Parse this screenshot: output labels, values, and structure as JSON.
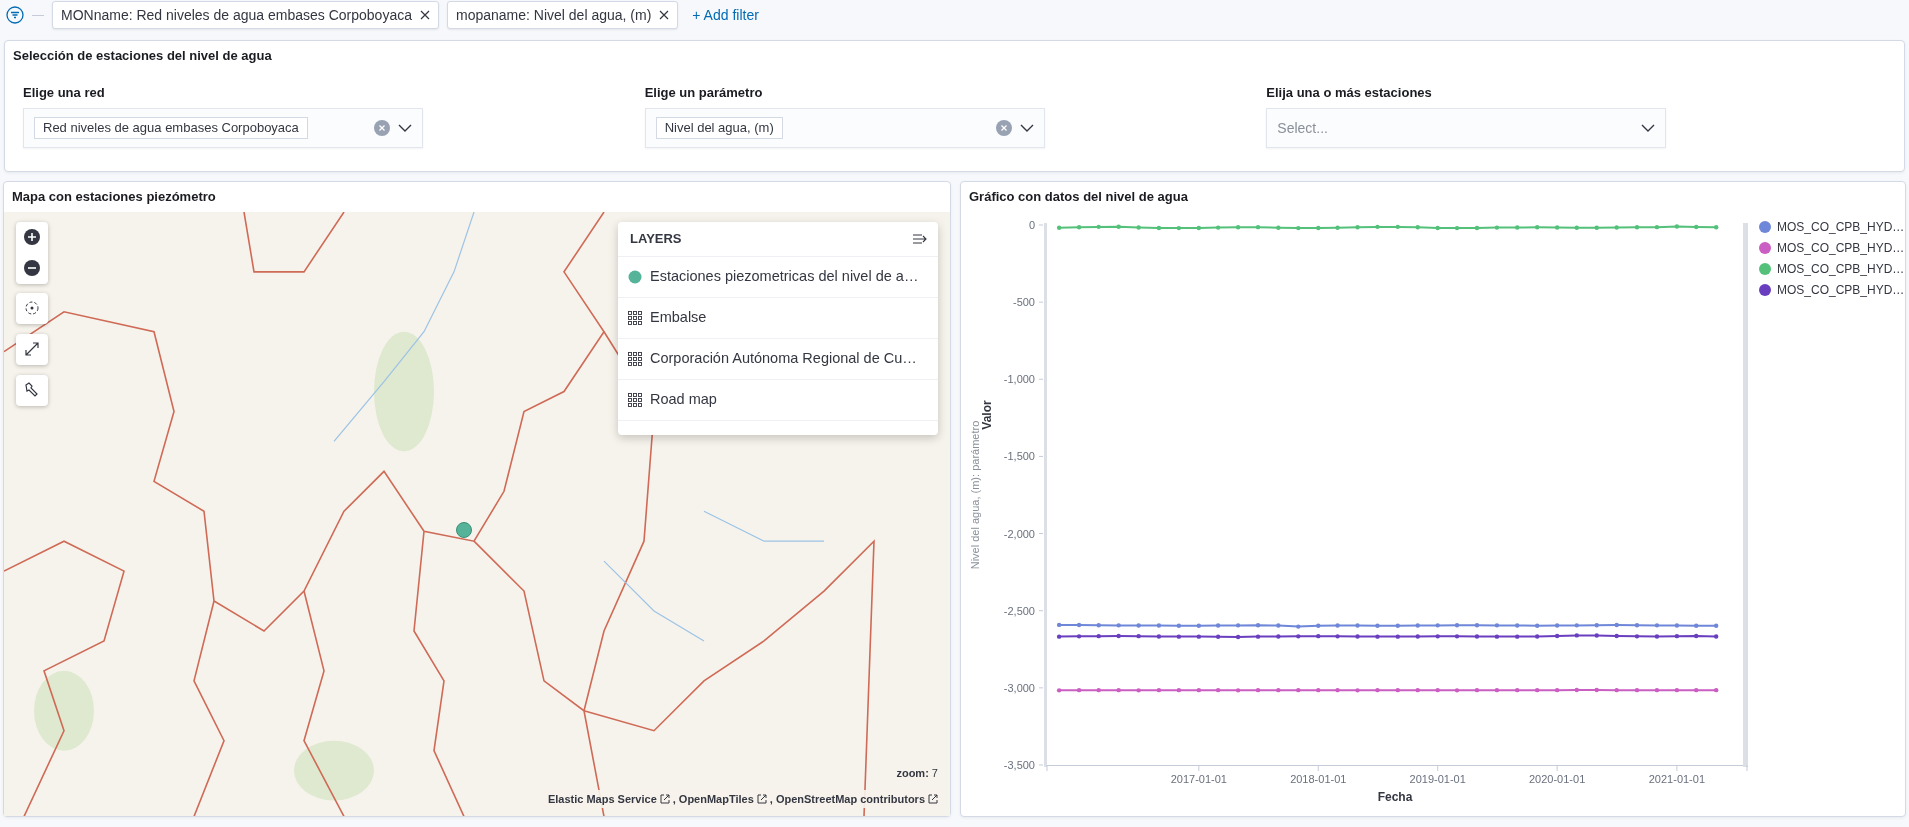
{
  "filter_bar": {
    "filters": [
      {
        "label": "MONname: Red niveles de agua embases Corpoboyaca"
      },
      {
        "label": "mopaname: Nivel del agua, (m)"
      }
    ],
    "add_filter": "+ Add filter"
  },
  "selection_panel": {
    "title": "Selección de estaciones del nivel de agua",
    "controls": [
      {
        "label": "Elige una red",
        "value": "Red niveles de agua embases Corpoboyaca"
      },
      {
        "label": "Elige un parámetro",
        "value": "Nivel del agua, (m)"
      },
      {
        "label": "Elija una o más estaciones",
        "placeholder": "Select..."
      }
    ]
  },
  "map_panel": {
    "title": "Mapa con estaciones piezómetro",
    "layers": {
      "title": "LAYERS",
      "items": [
        {
          "kind": "point",
          "label": "Estaciones piezometricas del nivel de a…"
        },
        {
          "kind": "tile",
          "label": "Embalse"
        },
        {
          "kind": "tile",
          "label": "Corporación Autónoma Regional de Cu…"
        },
        {
          "kind": "tile",
          "label": "Road map"
        }
      ]
    },
    "zoom": {
      "label": "zoom:",
      "value": "7"
    },
    "attribution_separator": ",",
    "attribution": [
      {
        "text": "Elastic Maps Service"
      },
      {
        "text": "OpenMapTiles"
      },
      {
        "text": "OpenStreetMap contributors"
      }
    ]
  },
  "chart_panel": {
    "title": "Gráfico con datos del nivel de agua",
    "axis_caption": "Nivel del agua, (m): parámetro",
    "chart_data": {
      "type": "line",
      "xlabel": "Fecha",
      "ylabel": "Valor",
      "x": [
        "2015-11-01",
        "2016-01-01",
        "2016-03-01",
        "2016-05-01",
        "2016-07-01",
        "2016-09-01",
        "2016-11-01",
        "2017-01-01",
        "2017-03-01",
        "2017-05-01",
        "2017-07-01",
        "2017-09-01",
        "2017-11-01",
        "2018-01-01",
        "2018-03-01",
        "2018-05-01",
        "2018-07-01",
        "2018-09-01",
        "2018-11-01",
        "2019-01-01",
        "2019-03-01",
        "2019-05-01",
        "2019-07-01",
        "2019-09-01",
        "2019-11-01",
        "2020-01-01",
        "2020-03-01",
        "2020-05-01",
        "2020-07-01",
        "2020-09-01",
        "2020-11-01",
        "2021-01-01",
        "2021-03-01",
        "2021-05-01"
      ],
      "xlim": [
        "2015-09-25",
        "2021-07-22"
      ],
      "ylim": [
        -3500,
        0
      ],
      "xticks": [
        "2017-01-01",
        "2018-01-01",
        "2019-01-01",
        "2020-01-01",
        "2021-01-01"
      ],
      "yticks": [
        {
          "value": 0,
          "label": "0"
        },
        {
          "value": -500,
          "label": "-500"
        },
        {
          "value": -1000,
          "label": "-1,000"
        },
        {
          "value": -1500,
          "label": "-1,500"
        },
        {
          "value": -2000,
          "label": "-2,000"
        },
        {
          "value": -2500,
          "label": "-2,500"
        },
        {
          "value": -3000,
          "label": "-3,000"
        },
        {
          "value": -3500,
          "label": "-3,500"
        }
      ],
      "series": [
        {
          "name": "MOS_CO_CPB_HYD…",
          "color": "#6f87d8",
          "values": [
            -2592,
            -2593,
            -2594,
            -2595,
            -2596,
            -2596,
            -2597,
            -2597,
            -2596,
            -2595,
            -2594,
            -2596,
            -2603,
            -2597,
            -2596,
            -2596,
            -2597,
            -2597,
            -2596,
            -2595,
            -2594,
            -2594,
            -2595,
            -2596,
            -2597,
            -2596,
            -2595,
            -2594,
            -2593,
            -2594,
            -2595,
            -2596,
            -2597,
            -2597
          ]
        },
        {
          "name": "MOS_CO_CPB_HYD…",
          "color": "#ca5ec2",
          "values": [
            -3016,
            -3015,
            -3015,
            -3015,
            -3016,
            -3015,
            -3015,
            -3015,
            -3015,
            -3016,
            -3015,
            -3015,
            -3015,
            -3015,
            -3015,
            -3016,
            -3015,
            -3015,
            -3015,
            -3015,
            -3016,
            -3015,
            -3015,
            -3015,
            -3015,
            -3015,
            -3014,
            -3014,
            -3015,
            -3015,
            -3015,
            -3015,
            -3015,
            -3015
          ]
        },
        {
          "name": "MOS_CO_CPB_HYD…",
          "color": "#54c17a",
          "values": [
            -18,
            -15,
            -12,
            -11,
            -16,
            -19,
            -20,
            -19,
            -17,
            -15,
            -14,
            -18,
            -20,
            -19,
            -18,
            -15,
            -12,
            -12,
            -15,
            -19,
            -20,
            -19,
            -17,
            -16,
            -15,
            -16,
            -18,
            -18,
            -16,
            -15,
            -14,
            -10,
            -13,
            -15
          ]
        },
        {
          "name": "MOS_CO_CPB_HYD…",
          "color": "#6a3fbf",
          "values": [
            -2668,
            -2666,
            -2665,
            -2664,
            -2665,
            -2667,
            -2668,
            -2668,
            -2669,
            -2670,
            -2668,
            -2667,
            -2666,
            -2665,
            -2666,
            -2667,
            -2668,
            -2668,
            -2667,
            -2666,
            -2666,
            -2667,
            -2668,
            -2668,
            -2667,
            -2664,
            -2660,
            -2661,
            -2664,
            -2666,
            -2667,
            -2665,
            -2664,
            -2667
          ]
        }
      ]
    }
  }
}
